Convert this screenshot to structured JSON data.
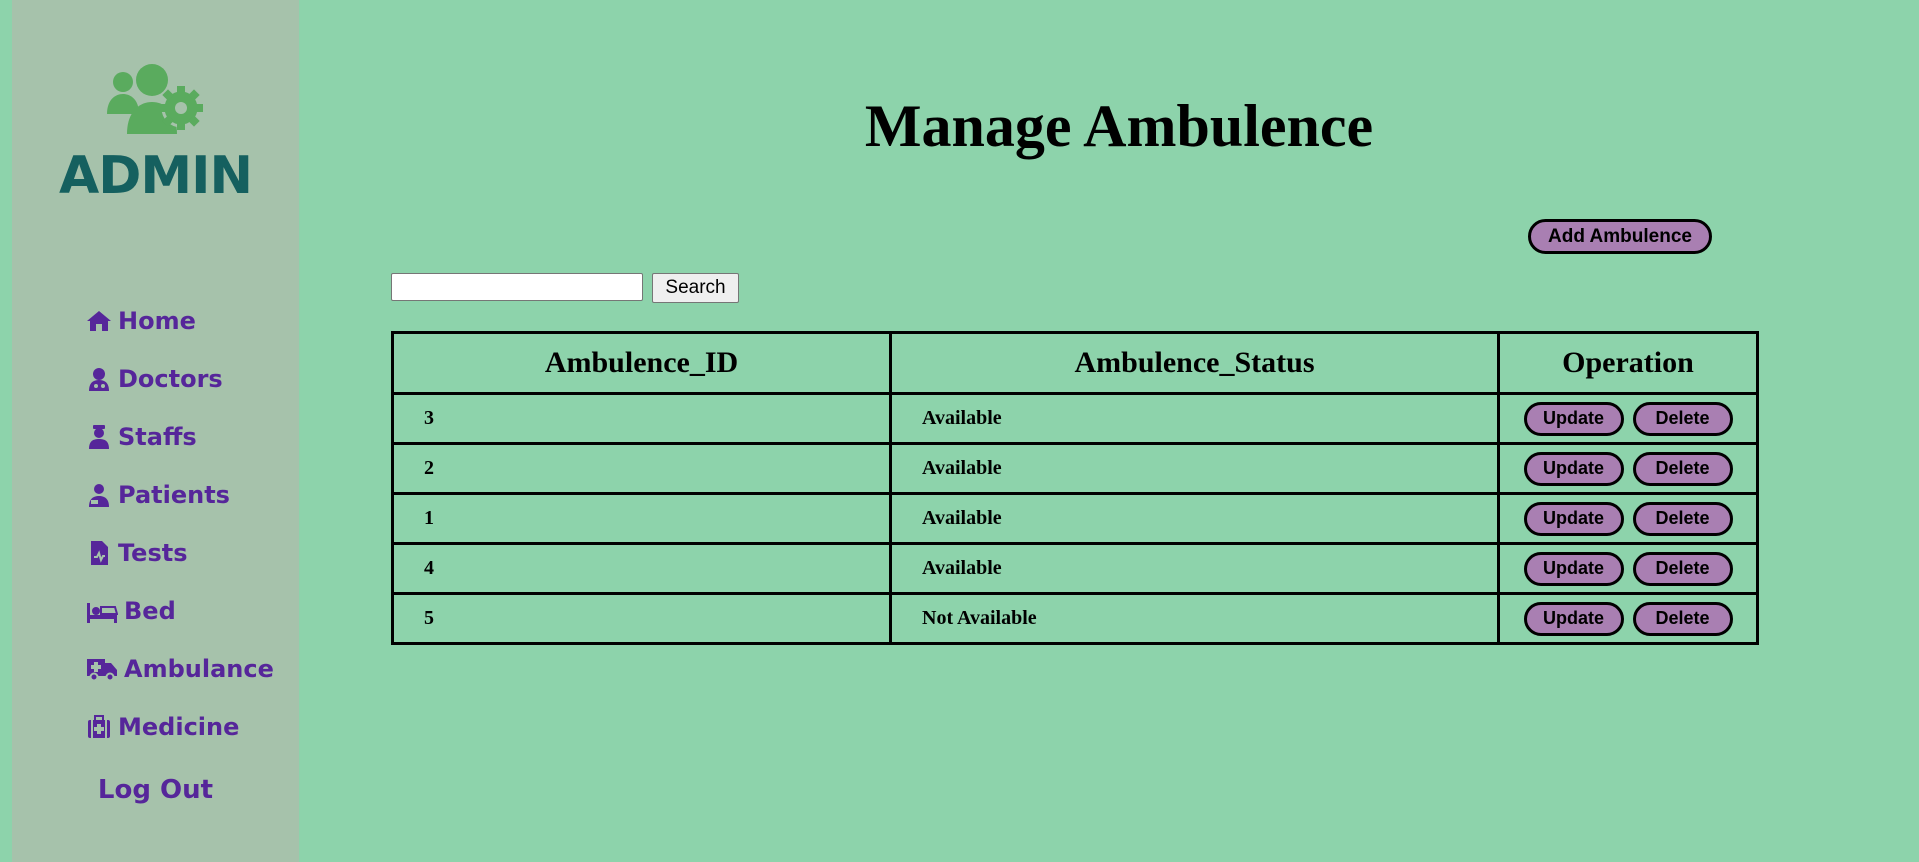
{
  "sidebar": {
    "logo_text": "ADMIN",
    "logo_icon": "users-gear-icon",
    "items": [
      {
        "label": "Home",
        "icon": "home-icon"
      },
      {
        "label": "Doctors",
        "icon": "doctor-icon"
      },
      {
        "label": "Staffs",
        "icon": "staff-icon"
      },
      {
        "label": "Patients",
        "icon": "patient-icon"
      },
      {
        "label": "Tests",
        "icon": "file-medical-icon"
      },
      {
        "label": "Bed",
        "icon": "bed-icon"
      },
      {
        "label": "Ambulance",
        "icon": "ambulance-icon"
      },
      {
        "label": "Medicine",
        "icon": "medkit-icon"
      }
    ],
    "logout_label": "Log Out"
  },
  "main": {
    "title": "Manage Ambulence",
    "add_button_label": "Add Ambulence",
    "search": {
      "value": "",
      "placeholder": "",
      "button_label": "Search"
    },
    "table": {
      "headers": [
        "Ambulence_ID",
        "Ambulence_Status",
        "Operation"
      ],
      "rows": [
        {
          "id": "3",
          "status": "Available"
        },
        {
          "id": "2",
          "status": "Available"
        },
        {
          "id": "1",
          "status": "Available"
        },
        {
          "id": "4",
          "status": "Available"
        },
        {
          "id": "5",
          "status": "Not Available"
        }
      ],
      "update_label": "Update",
      "delete_label": "Delete"
    }
  },
  "colors": {
    "page_bg": "#8dd3ab",
    "sidebar_bg": "#a6c2ab",
    "nav_text": "#56269a",
    "logo_text": "#15605f",
    "logo_icon": "#5aab5e",
    "button_bg": "#a97fb2"
  }
}
